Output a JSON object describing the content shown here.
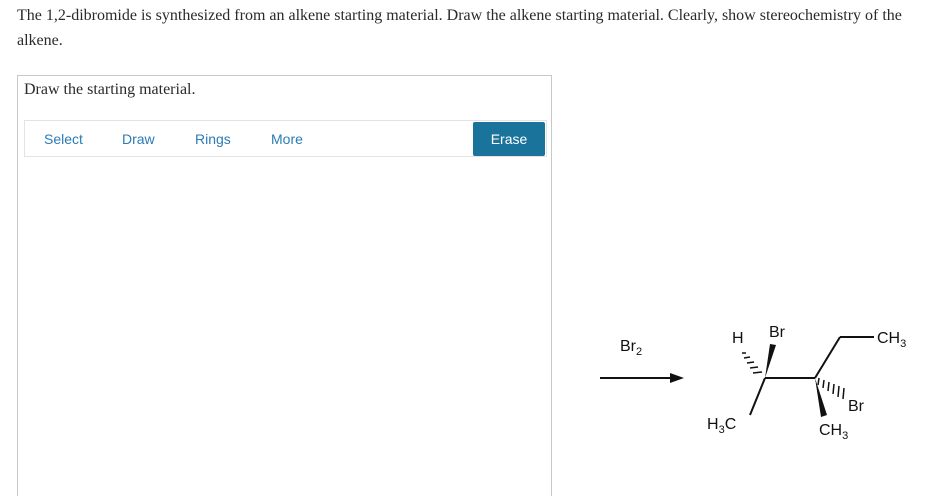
{
  "question": {
    "text": "The 1,2-dibromide is synthesized from an alkene starting material. Draw the alkene starting material. Clearly, show stereochemistry of the alkene."
  },
  "panel": {
    "title": "Draw the starting material.",
    "toolbar": {
      "select": "Select",
      "draw": "Draw",
      "rings": "Rings",
      "more": "More",
      "erase": "Erase",
      "erase_color": "#19739b",
      "link_color": "#2b7bb5"
    }
  },
  "reaction": {
    "reagent": "Br",
    "reagent_subscript": "2",
    "product_labels": {
      "h": "H",
      "br_top": "Br",
      "h3c": "H",
      "h3c_sub": "3",
      "h3c_c": "C",
      "ch3_right": "CH",
      "ch3_right_sub": "3",
      "br_right": "Br",
      "ch3_bottom": "CH",
      "ch3_bottom_sub": "3"
    }
  }
}
